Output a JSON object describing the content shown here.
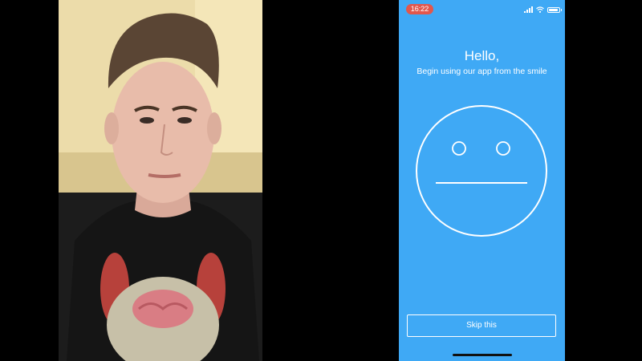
{
  "status_bar": {
    "time": "16:22",
    "icons": [
      "signal-icon",
      "wifi-icon",
      "battery-icon"
    ]
  },
  "onboarding": {
    "greeting": "Hello,",
    "subtitle": "Begin using our app from the smile",
    "face_icon": "neutral-face-icon",
    "skip_label": "Skip this"
  },
  "colors": {
    "phone_background": "#3fa9f5",
    "time_pill": "#e2574c",
    "page_background": "#000000",
    "foreground": "#ffffff"
  }
}
